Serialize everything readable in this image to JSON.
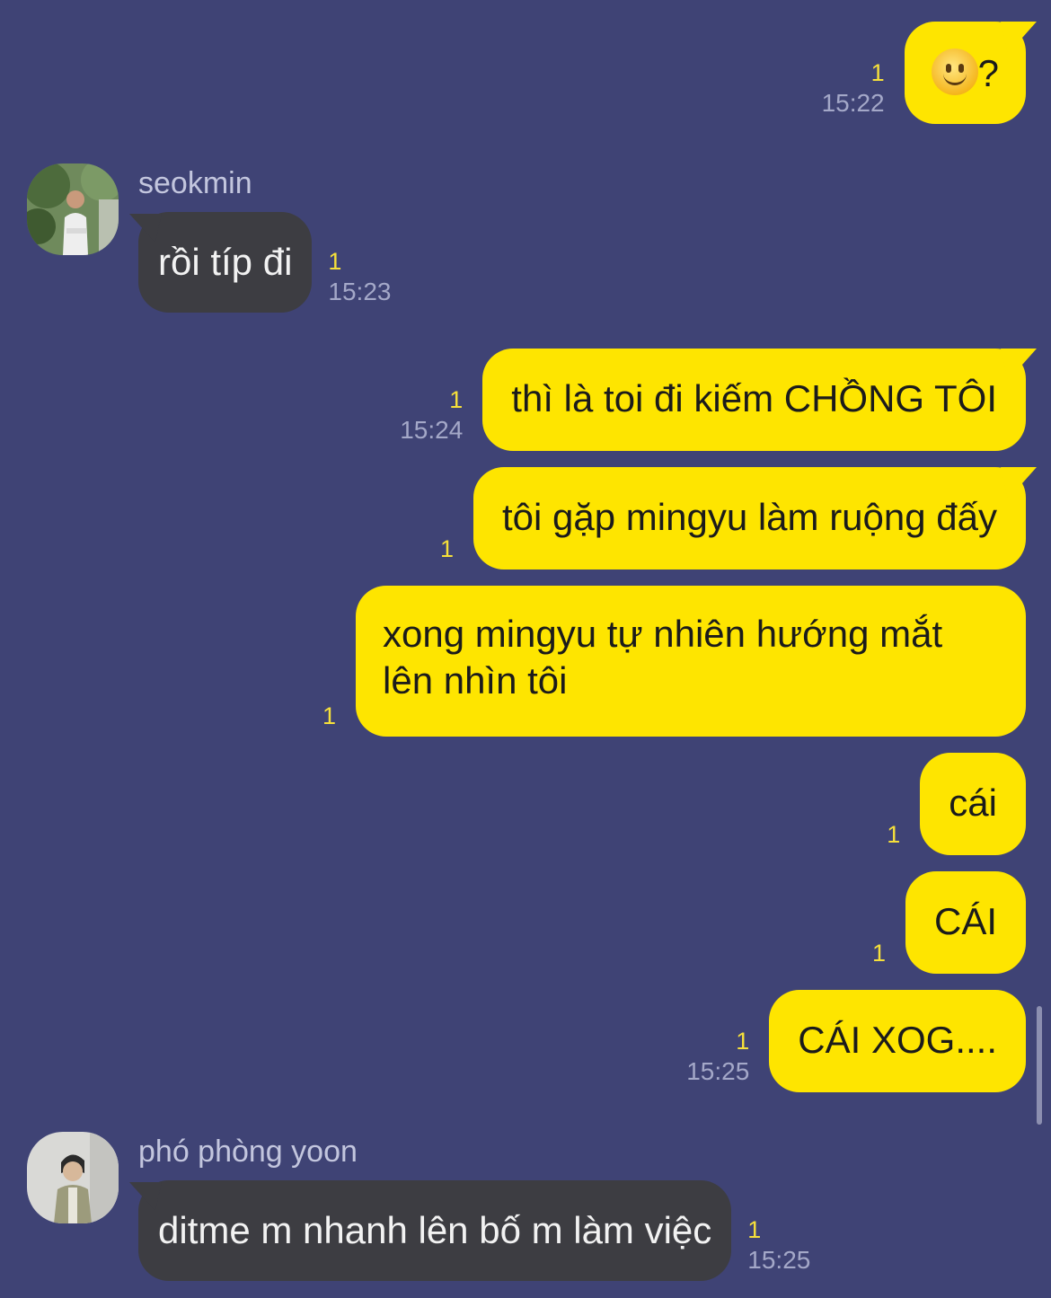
{
  "messages_out_1": {
    "unread": "1",
    "time": "15:22",
    "emoji": "slightly-smiling-face",
    "text": "?"
  },
  "seokmin": {
    "name": "seokmin",
    "message": "rồi típ đi",
    "unread": "1",
    "time": "15:23"
  },
  "messages_out_2": [
    {
      "text": "thì là toi đi kiếm CHỒNG TÔI",
      "unread": "1",
      "time": "15:24"
    },
    {
      "text": "tôi gặp mingyu làm ruộng đấy",
      "unread": "1"
    },
    {
      "text": "xong mingyu tự nhiên hướng mắt lên nhìn tôi",
      "unread": "1"
    },
    {
      "text": "cái",
      "unread": "1"
    },
    {
      "text": "CÁI",
      "unread": "1"
    },
    {
      "text": "CÁI XOG....",
      "unread": "1",
      "time": "15:25"
    }
  ],
  "yoon": {
    "name": "phó phòng yoon",
    "message": "ditme m nhanh lên bố m làm việc",
    "unread": "1",
    "time": "15:25"
  },
  "colors": {
    "background": "#3f4375",
    "outgoing_bubble": "#fee500",
    "incoming_bubble": "#3d3d42",
    "unread_count": "#f6e03a"
  }
}
